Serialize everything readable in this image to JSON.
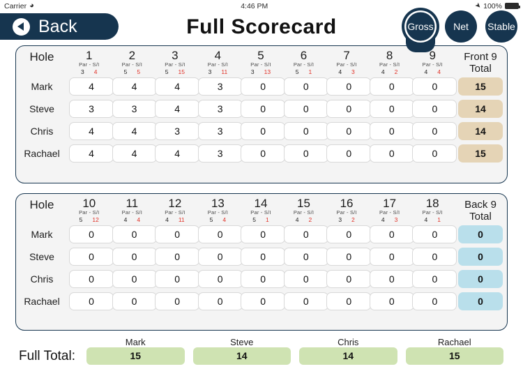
{
  "status_bar": {
    "carrier": "Carrier",
    "wifi_icon": "wifi-icon",
    "time": "4:46 PM",
    "location_icon": "location-arrow-icon",
    "battery_percent": "100%",
    "battery_icon": "battery-full-icon"
  },
  "navbar": {
    "back_label": "Back",
    "back_icon": "back-arrow-icon",
    "title": "Full Scorecard",
    "modes": [
      {
        "label": "Gross",
        "selected": true
      },
      {
        "label": "Net",
        "selected": false
      },
      {
        "label": "Stable",
        "selected": false
      }
    ]
  },
  "theme": {
    "navy": "#16354f",
    "si_red": "#e03127",
    "total_front_bg": "#e5d4b6",
    "total_back_bg": "#b9dfeb",
    "full_total_bg": "#cfe3b2",
    "card_bg": "#f4f4f4"
  },
  "labels": {
    "hole": "Hole",
    "par": "Par",
    "separator": "-",
    "si": "S/I",
    "front_total": "Front 9\nTotal",
    "front_total_line1": "Front 9",
    "front_total_line2": "Total",
    "back_total_line1": "Back 9",
    "back_total_line2": "Total",
    "full_total": "Full Total:"
  },
  "players": [
    "Mark",
    "Steve",
    "Chris",
    "Rachael"
  ],
  "front_nine": {
    "holes": [
      "1",
      "2",
      "3",
      "4",
      "5",
      "6",
      "7",
      "8",
      "9"
    ],
    "par": [
      3,
      5,
      5,
      3,
      3,
      5,
      4,
      4,
      4
    ],
    "si": [
      4,
      5,
      15,
      11,
      13,
      1,
      3,
      2,
      4
    ],
    "scores": {
      "Mark": [
        4,
        4,
        4,
        3,
        0,
        0,
        0,
        0,
        0
      ],
      "Steve": [
        3,
        3,
        4,
        3,
        0,
        0,
        0,
        0,
        0
      ],
      "Chris": [
        4,
        4,
        3,
        3,
        0,
        0,
        0,
        0,
        0
      ],
      "Rachael": [
        4,
        4,
        4,
        3,
        0,
        0,
        0,
        0,
        0
      ]
    },
    "totals": {
      "Mark": 15,
      "Steve": 14,
      "Chris": 14,
      "Rachael": 15
    }
  },
  "back_nine": {
    "holes": [
      "10",
      "11",
      "12",
      "13",
      "14",
      "15",
      "16",
      "17",
      "18"
    ],
    "par": [
      5,
      4,
      4,
      5,
      5,
      4,
      3,
      4,
      4
    ],
    "si": [
      12,
      4,
      11,
      4,
      1,
      2,
      2,
      3,
      1
    ],
    "scores": {
      "Mark": [
        0,
        0,
        0,
        0,
        0,
        0,
        0,
        0,
        0
      ],
      "Steve": [
        0,
        0,
        0,
        0,
        0,
        0,
        0,
        0,
        0
      ],
      "Chris": [
        0,
        0,
        0,
        0,
        0,
        0,
        0,
        0,
        0
      ],
      "Rachael": [
        0,
        0,
        0,
        0,
        0,
        0,
        0,
        0,
        0
      ]
    },
    "totals": {
      "Mark": 0,
      "Steve": 0,
      "Chris": 0,
      "Rachael": 0
    }
  },
  "full_totals": {
    "Mark": 15,
    "Steve": 14,
    "Chris": 14,
    "Rachael": 15
  }
}
